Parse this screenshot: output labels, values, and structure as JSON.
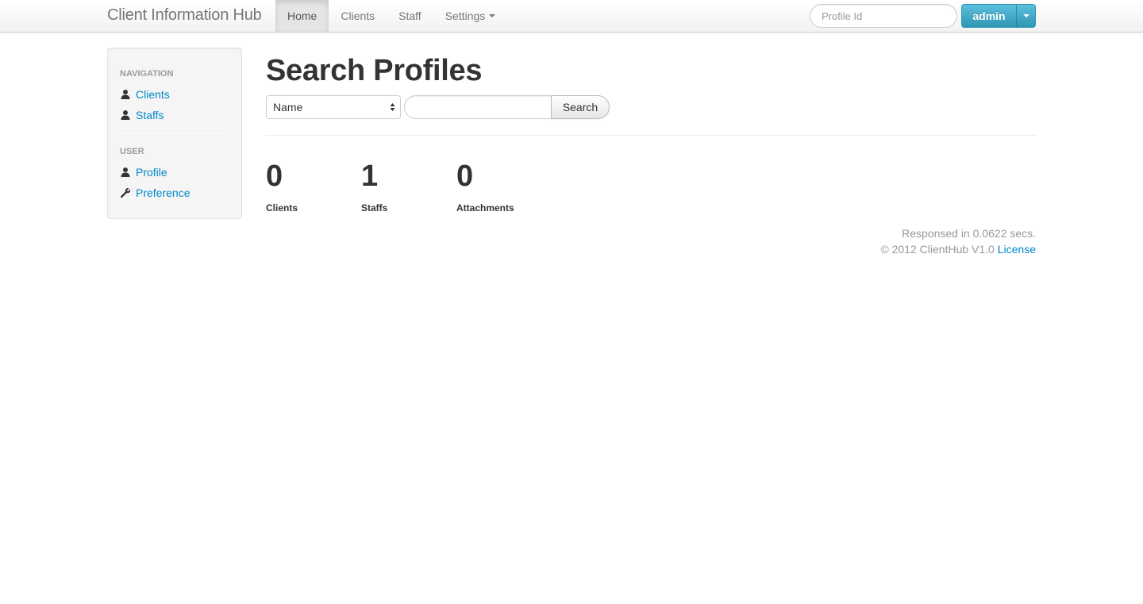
{
  "navbar": {
    "brand": "Client Information Hub",
    "items": [
      {
        "label": "Home",
        "active": true
      },
      {
        "label": "Clients",
        "active": false
      },
      {
        "label": "Staff",
        "active": false
      },
      {
        "label": "Settings",
        "active": false,
        "dropdown": true
      }
    ],
    "profile_search_placeholder": "Profile Id",
    "user_button_label": "admin"
  },
  "sidebar": {
    "sections": [
      {
        "header": "NAVIGATION",
        "items": [
          {
            "label": "Clients",
            "icon": "user-icon"
          },
          {
            "label": "Staffs",
            "icon": "user-icon"
          }
        ]
      },
      {
        "header": "USER",
        "items": [
          {
            "label": "Profile",
            "icon": "user-icon"
          },
          {
            "label": "Preference",
            "icon": "wrench-icon"
          }
        ]
      }
    ]
  },
  "main": {
    "title": "Search Profiles",
    "search": {
      "field_selected": "Name",
      "query_value": "",
      "button_label": "Search"
    },
    "stats": [
      {
        "value": "0",
        "label": "Clients"
      },
      {
        "value": "1",
        "label": "Staffs"
      },
      {
        "value": "0",
        "label": "Attachments"
      }
    ]
  },
  "footer": {
    "response_time": "Responsed in 0.0622 secs.",
    "copyright": "© 2012 ClientHub V1.0",
    "license_link": "License"
  },
  "colors": {
    "link": "#0088cc",
    "primary_button": "#2f96b4",
    "muted_text": "#999999",
    "nav_active_bg": "#e5e5e5"
  }
}
